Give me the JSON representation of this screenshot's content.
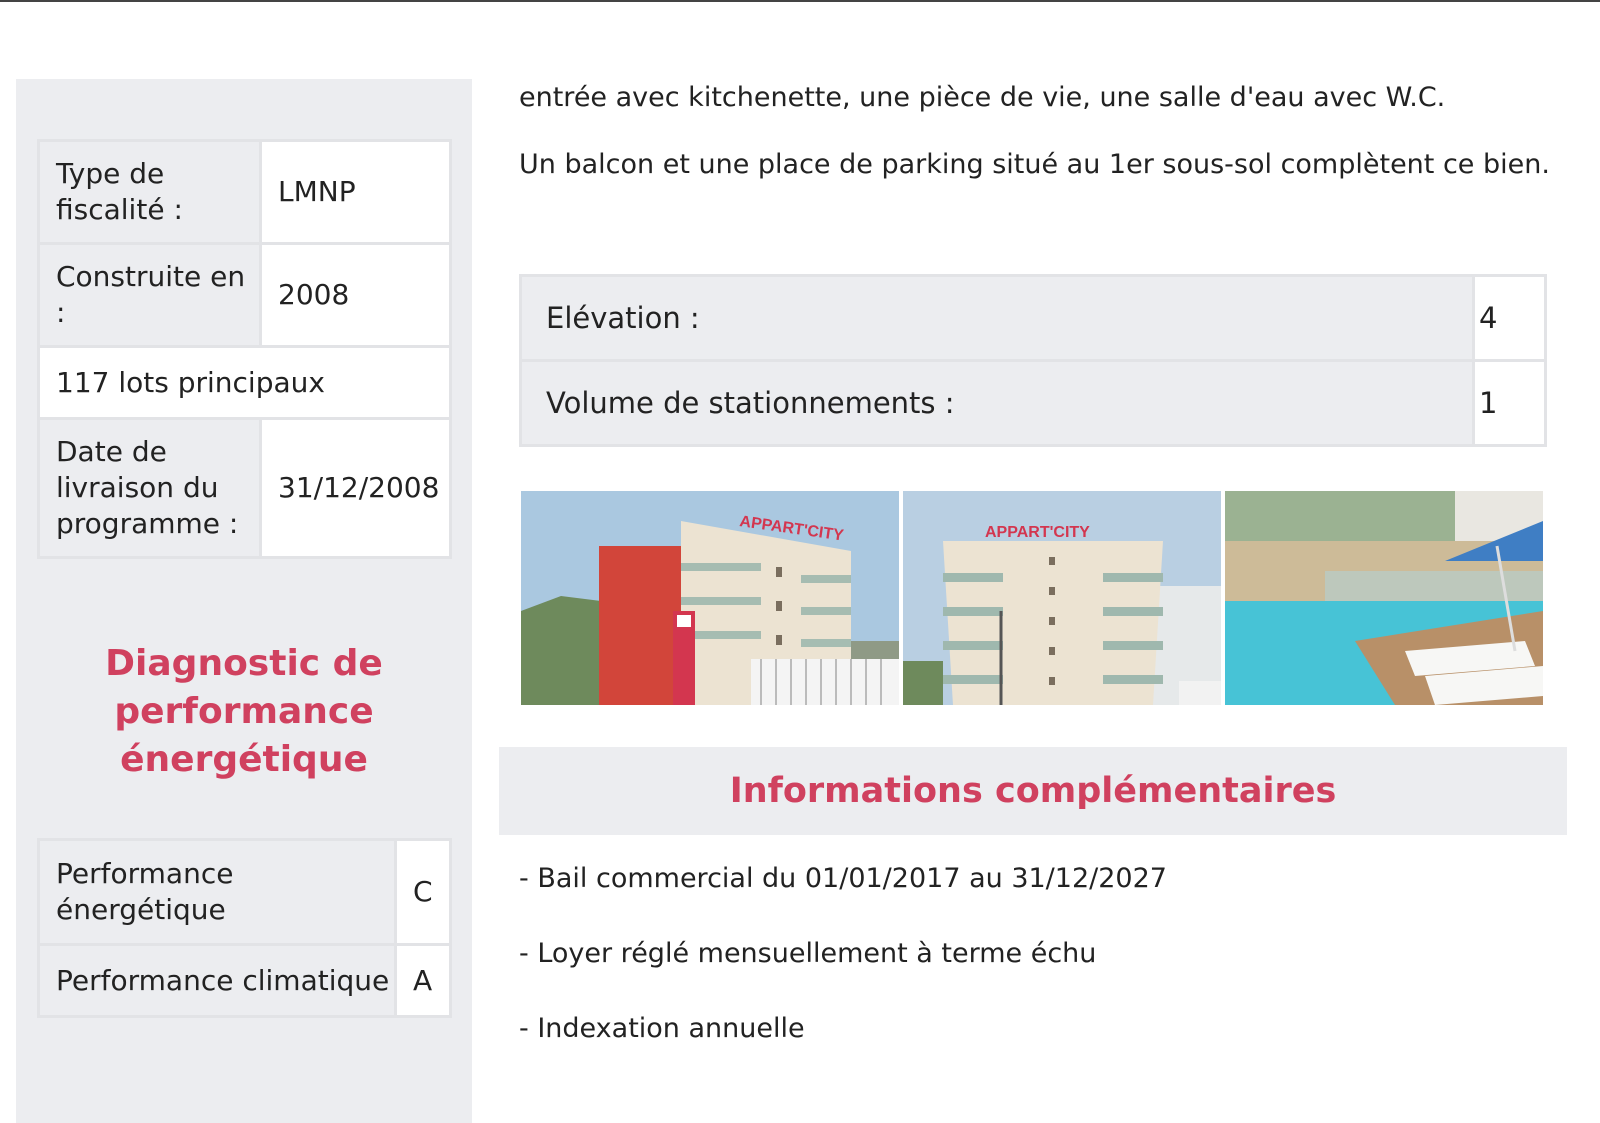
{
  "intro": {
    "line1": "entrée avec kitchenette, une pièce de vie, une salle d'eau avec W.C.",
    "line2": "Un balcon et une place de parking situé au 1er sous-sol complètent ce bien."
  },
  "property": {
    "fiscalite_label_1": "Type de",
    "fiscalite_label_2": "fiscalité :",
    "fiscalite_value": "LMNP",
    "construite_label_1": "Construite en",
    "construite_label_2": ":",
    "construite_value": "2008",
    "lots": "117 lots principaux",
    "livraison_label_1": "Date de",
    "livraison_label_2": "livraison du",
    "livraison_label_3": "programme :",
    "livraison_value": "31/12/2008"
  },
  "dpe": {
    "title_1": "Diagnostic de",
    "title_2": "performance",
    "title_3": "énergétique",
    "energetique_label_1": "Performance",
    "energetique_label_2": "énergétique",
    "energetique_value": "C",
    "climatique_label": "Performance climatique",
    "climatique_value": "A"
  },
  "specs": {
    "elevation_label": "Elévation :",
    "elevation_value": "4",
    "stationnements_label": "Volume de stationnements :",
    "stationnements_value": "1"
  },
  "gallery": {
    "sign_text": "APPART'CITY",
    "photos": [
      "building-side-view",
      "building-front-view",
      "pool-terrace"
    ],
    "colors": {
      "sky": "#aac8e0",
      "facade": "#ece3d2",
      "red_accent": "#d2453a",
      "pool": "#47c3d6",
      "sign": "#d3364f"
    }
  },
  "info": {
    "title": "Informations complémentaires",
    "items": [
      "- Bail commercial du 01/01/2017 au 31/12/2027",
      "- Loyer réglé mensuellement à terme échu",
      "- Indexation annuelle"
    ]
  },
  "theme": {
    "accent": "#d0415f",
    "panel": "#ecedf0",
    "border": "#e2e3e6"
  }
}
